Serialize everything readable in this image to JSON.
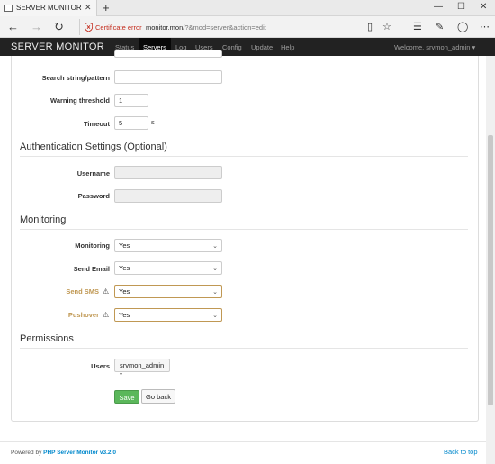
{
  "browser": {
    "tab_title": "SERVER MONITOR",
    "tab_close": "✕",
    "new_tab": "+",
    "window_controls": [
      "—",
      "☐",
      "✕"
    ],
    "cert_error": "Certificate error",
    "url_host": "monitor.mon",
    "url_rest": "/?&mod=server&action=edit"
  },
  "app": {
    "brand": "SERVER MONITOR",
    "nav": [
      "Status",
      "Servers",
      "Log",
      "Users",
      "Config",
      "Update",
      "Help"
    ],
    "active_nav": "Servers",
    "welcome": "Welcome, srvmon_admin ▾"
  },
  "form": {
    "search_label": "Search string/pattern",
    "search_value": "",
    "warning_label": "Warning threshold",
    "warning_value": "1",
    "timeout_label": "Timeout",
    "timeout_value": "5",
    "timeout_unit": "s",
    "auth_title": "Authentication Settings (Optional)",
    "username_label": "Username",
    "password_label": "Password",
    "monitoring_title": "Monitoring",
    "monitoring_label": "Monitoring",
    "monitoring_value": "Yes",
    "send_email_label": "Send Email",
    "send_email_value": "Yes",
    "send_sms_label": "Send SMS",
    "send_sms_value": "Yes",
    "pushover_label": "Pushover",
    "pushover_value": "Yes",
    "warn_icon": "⚠",
    "permissions_title": "Permissions",
    "users_label": "Users",
    "users_value": "srvmon_admin",
    "save_label": "Save",
    "back_label": "Go back"
  },
  "footer": {
    "powered_prefix": "Powered by ",
    "powered_link": "PHP Server Monitor v3.2.0",
    "back_to_top": "Back to top"
  }
}
